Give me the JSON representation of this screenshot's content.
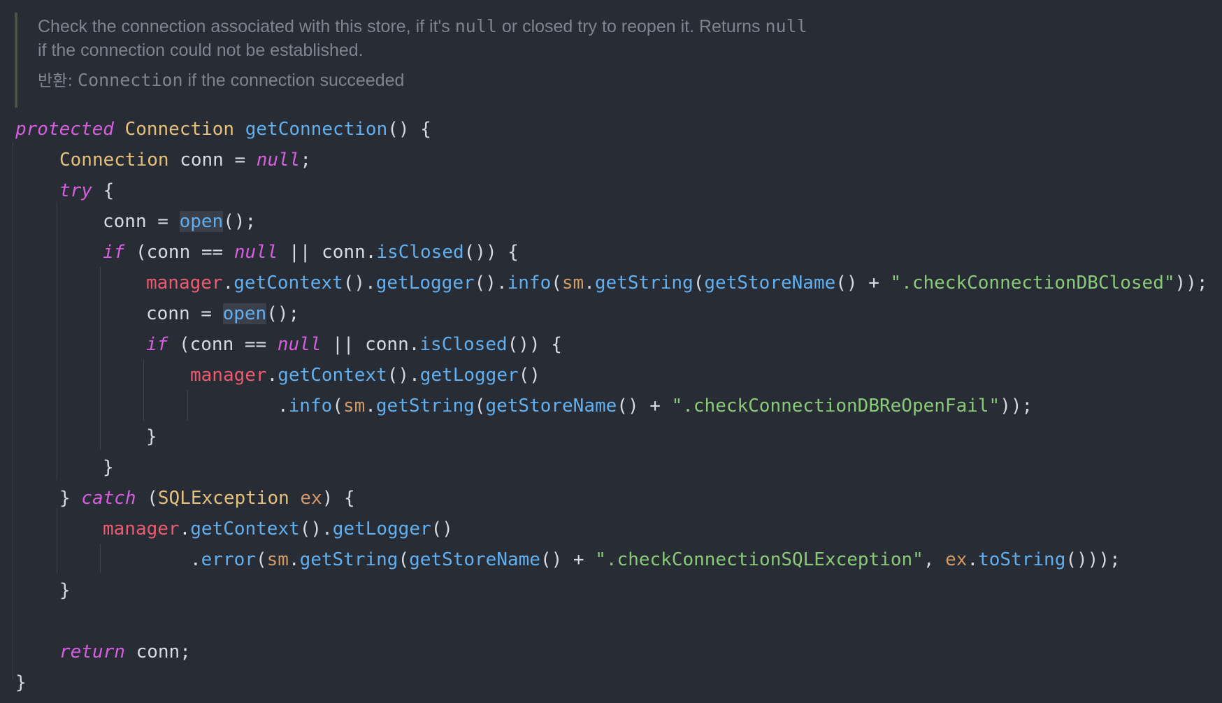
{
  "doc": {
    "line1_a": "Check the connection associated with this store, if it's ",
    "line1_code1": "null",
    "line1_b": " or closed try to reopen it. Returns ",
    "line1_code2": "null",
    "line2": "if the connection could not be established.",
    "returns_label": "반환:",
    "returns_code": "Connection",
    "returns_text": " if the connection succeeded"
  },
  "code": {
    "kw_protected": "protected",
    "kw_null": "null",
    "kw_try": "try",
    "kw_if": "if",
    "kw_catch": "catch",
    "kw_return": "return",
    "type_connection": "Connection",
    "type_sqlexception": "SQLException",
    "method_getconnection": "getConnection",
    "method_open": "open",
    "method_isclosed": "isClosed",
    "method_getcontext": "getContext",
    "method_getlogger": "getLogger",
    "method_info": "info",
    "method_error": "error",
    "method_getstring": "getString",
    "method_getstorename": "getStoreName",
    "method_tostring": "toString",
    "field_manager": "manager",
    "field_sm": "sm",
    "var_conn": "conn",
    "param_ex": "ex",
    "str_dbclosed": "\".checkConnectionDBClosed\"",
    "str_reopenfail": "\".checkConnectionDBReOpenFail\"",
    "str_sqlexception": "\".checkConnectionSQLException\""
  },
  "colors": {
    "background": "#282c34",
    "keyword": "#d55fde",
    "type": "#e5c07b",
    "function": "#61afef",
    "field": "#ef596f",
    "string": "#89ca78",
    "parameter": "#d19a66",
    "text": "#d7dae0",
    "doc_comment": "#7f858f"
  }
}
